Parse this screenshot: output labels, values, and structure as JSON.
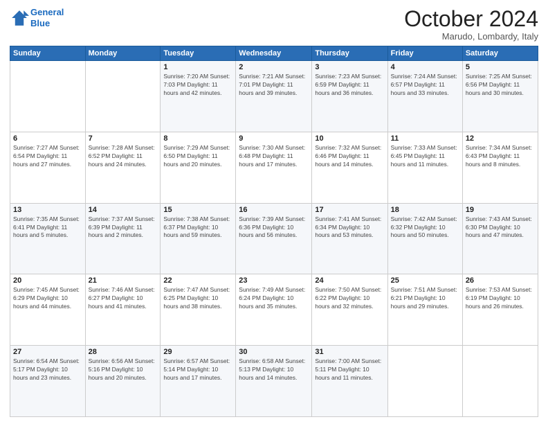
{
  "logo": {
    "line1": "General",
    "line2": "Blue"
  },
  "title": "October 2024",
  "subtitle": "Marudo, Lombardy, Italy",
  "headers": [
    "Sunday",
    "Monday",
    "Tuesday",
    "Wednesday",
    "Thursday",
    "Friday",
    "Saturday"
  ],
  "weeks": [
    [
      {
        "day": "",
        "info": ""
      },
      {
        "day": "",
        "info": ""
      },
      {
        "day": "1",
        "info": "Sunrise: 7:20 AM\nSunset: 7:03 PM\nDaylight: 11 hours and 42 minutes."
      },
      {
        "day": "2",
        "info": "Sunrise: 7:21 AM\nSunset: 7:01 PM\nDaylight: 11 hours and 39 minutes."
      },
      {
        "day": "3",
        "info": "Sunrise: 7:23 AM\nSunset: 6:59 PM\nDaylight: 11 hours and 36 minutes."
      },
      {
        "day": "4",
        "info": "Sunrise: 7:24 AM\nSunset: 6:57 PM\nDaylight: 11 hours and 33 minutes."
      },
      {
        "day": "5",
        "info": "Sunrise: 7:25 AM\nSunset: 6:56 PM\nDaylight: 11 hours and 30 minutes."
      }
    ],
    [
      {
        "day": "6",
        "info": "Sunrise: 7:27 AM\nSunset: 6:54 PM\nDaylight: 11 hours and 27 minutes."
      },
      {
        "day": "7",
        "info": "Sunrise: 7:28 AM\nSunset: 6:52 PM\nDaylight: 11 hours and 24 minutes."
      },
      {
        "day": "8",
        "info": "Sunrise: 7:29 AM\nSunset: 6:50 PM\nDaylight: 11 hours and 20 minutes."
      },
      {
        "day": "9",
        "info": "Sunrise: 7:30 AM\nSunset: 6:48 PM\nDaylight: 11 hours and 17 minutes."
      },
      {
        "day": "10",
        "info": "Sunrise: 7:32 AM\nSunset: 6:46 PM\nDaylight: 11 hours and 14 minutes."
      },
      {
        "day": "11",
        "info": "Sunrise: 7:33 AM\nSunset: 6:45 PM\nDaylight: 11 hours and 11 minutes."
      },
      {
        "day": "12",
        "info": "Sunrise: 7:34 AM\nSunset: 6:43 PM\nDaylight: 11 hours and 8 minutes."
      }
    ],
    [
      {
        "day": "13",
        "info": "Sunrise: 7:35 AM\nSunset: 6:41 PM\nDaylight: 11 hours and 5 minutes."
      },
      {
        "day": "14",
        "info": "Sunrise: 7:37 AM\nSunset: 6:39 PM\nDaylight: 11 hours and 2 minutes."
      },
      {
        "day": "15",
        "info": "Sunrise: 7:38 AM\nSunset: 6:37 PM\nDaylight: 10 hours and 59 minutes."
      },
      {
        "day": "16",
        "info": "Sunrise: 7:39 AM\nSunset: 6:36 PM\nDaylight: 10 hours and 56 minutes."
      },
      {
        "day": "17",
        "info": "Sunrise: 7:41 AM\nSunset: 6:34 PM\nDaylight: 10 hours and 53 minutes."
      },
      {
        "day": "18",
        "info": "Sunrise: 7:42 AM\nSunset: 6:32 PM\nDaylight: 10 hours and 50 minutes."
      },
      {
        "day": "19",
        "info": "Sunrise: 7:43 AM\nSunset: 6:30 PM\nDaylight: 10 hours and 47 minutes."
      }
    ],
    [
      {
        "day": "20",
        "info": "Sunrise: 7:45 AM\nSunset: 6:29 PM\nDaylight: 10 hours and 44 minutes."
      },
      {
        "day": "21",
        "info": "Sunrise: 7:46 AM\nSunset: 6:27 PM\nDaylight: 10 hours and 41 minutes."
      },
      {
        "day": "22",
        "info": "Sunrise: 7:47 AM\nSunset: 6:25 PM\nDaylight: 10 hours and 38 minutes."
      },
      {
        "day": "23",
        "info": "Sunrise: 7:49 AM\nSunset: 6:24 PM\nDaylight: 10 hours and 35 minutes."
      },
      {
        "day": "24",
        "info": "Sunrise: 7:50 AM\nSunset: 6:22 PM\nDaylight: 10 hours and 32 minutes."
      },
      {
        "day": "25",
        "info": "Sunrise: 7:51 AM\nSunset: 6:21 PM\nDaylight: 10 hours and 29 minutes."
      },
      {
        "day": "26",
        "info": "Sunrise: 7:53 AM\nSunset: 6:19 PM\nDaylight: 10 hours and 26 minutes."
      }
    ],
    [
      {
        "day": "27",
        "info": "Sunrise: 6:54 AM\nSunset: 5:17 PM\nDaylight: 10 hours and 23 minutes."
      },
      {
        "day": "28",
        "info": "Sunrise: 6:56 AM\nSunset: 5:16 PM\nDaylight: 10 hours and 20 minutes."
      },
      {
        "day": "29",
        "info": "Sunrise: 6:57 AM\nSunset: 5:14 PM\nDaylight: 10 hours and 17 minutes."
      },
      {
        "day": "30",
        "info": "Sunrise: 6:58 AM\nSunset: 5:13 PM\nDaylight: 10 hours and 14 minutes."
      },
      {
        "day": "31",
        "info": "Sunrise: 7:00 AM\nSunset: 5:11 PM\nDaylight: 10 hours and 11 minutes."
      },
      {
        "day": "",
        "info": ""
      },
      {
        "day": "",
        "info": ""
      }
    ]
  ]
}
